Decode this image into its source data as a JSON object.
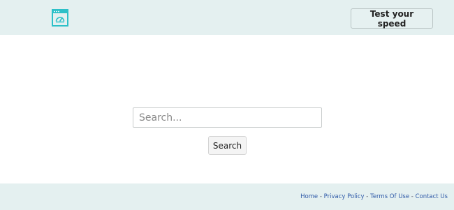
{
  "header": {
    "logo_icon": "speedometer-browser-icon",
    "speed_button_label": "Test your speed"
  },
  "search": {
    "placeholder": "Search...",
    "value": "",
    "button_label": "Search"
  },
  "footer": {
    "links": [
      "Home",
      "Privacy Policy",
      "Terms Of Use",
      "Contact Us"
    ],
    "separator": " - "
  },
  "colors": {
    "header_bg": "#e4f0f0",
    "accent": "#2cc0c8",
    "link": "#2f5aa8"
  }
}
